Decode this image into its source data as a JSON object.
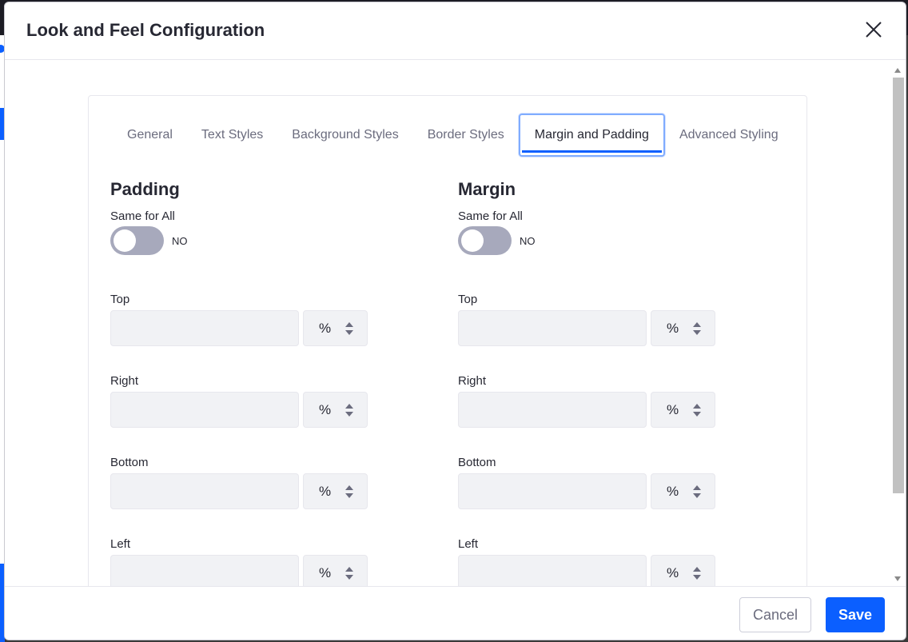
{
  "modal": {
    "title": "Look and Feel Configuration"
  },
  "tabs": [
    {
      "label": "General",
      "active": false
    },
    {
      "label": "Text Styles",
      "active": false
    },
    {
      "label": "Background Styles",
      "active": false
    },
    {
      "label": "Border Styles",
      "active": false
    },
    {
      "label": "Margin and Padding",
      "active": true
    },
    {
      "label": "Advanced Styling",
      "active": false
    }
  ],
  "padding": {
    "title": "Padding",
    "same_for_all_label": "Same for All",
    "toggle_state": "NO",
    "fields": [
      {
        "label": "Top",
        "value": "",
        "unit": "%"
      },
      {
        "label": "Right",
        "value": "",
        "unit": "%"
      },
      {
        "label": "Bottom",
        "value": "",
        "unit": "%"
      },
      {
        "label": "Left",
        "value": "",
        "unit": "%"
      }
    ]
  },
  "margin": {
    "title": "Margin",
    "same_for_all_label": "Same for All",
    "toggle_state": "NO",
    "fields": [
      {
        "label": "Top",
        "value": "",
        "unit": "%"
      },
      {
        "label": "Right",
        "value": "",
        "unit": "%"
      },
      {
        "label": "Bottom",
        "value": "",
        "unit": "%"
      },
      {
        "label": "Left",
        "value": "",
        "unit": "%"
      }
    ]
  },
  "footer": {
    "cancel_label": "Cancel",
    "save_label": "Save"
  },
  "colors": {
    "primary": "#0b5fff",
    "input_bg": "#f1f2f5",
    "toggle_off": "#a7a9bc"
  }
}
